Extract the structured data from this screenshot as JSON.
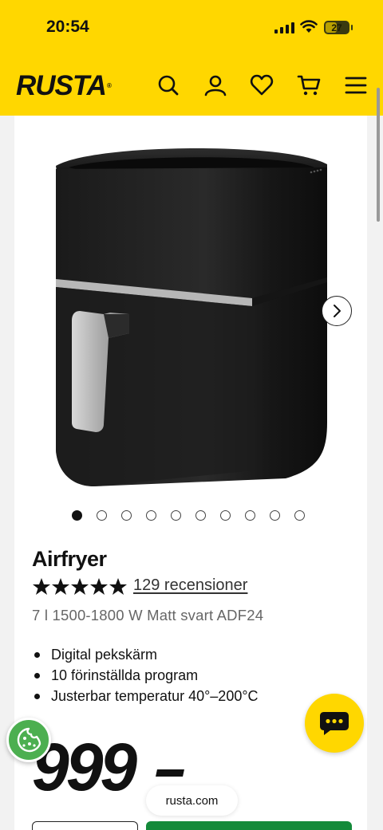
{
  "status_bar": {
    "time": "20:54",
    "battery": "27"
  },
  "header": {
    "logo": "RUSTA",
    "bg_color": "#ffd700",
    "icons": [
      "search-icon",
      "account-icon",
      "heart-icon",
      "cart-icon",
      "menu-icon"
    ]
  },
  "product": {
    "title": "Airfryer",
    "rating": 5,
    "reviews": "129 recensioner",
    "subtitle": "7 l 1500-1800 W Matt svart ADF24",
    "features": [
      "Digital pekskärm",
      "10 förinställda program",
      "Justerbar temperatur 40°–200°C"
    ],
    "price": "999"
  },
  "gallery": {
    "image_count": 10,
    "active_index": 0
  },
  "browser": {
    "url": "rusta.com"
  },
  "colors": {
    "accent": "#ffd700",
    "buy_button": "#148a3a",
    "cookie": "#4caf50"
  }
}
